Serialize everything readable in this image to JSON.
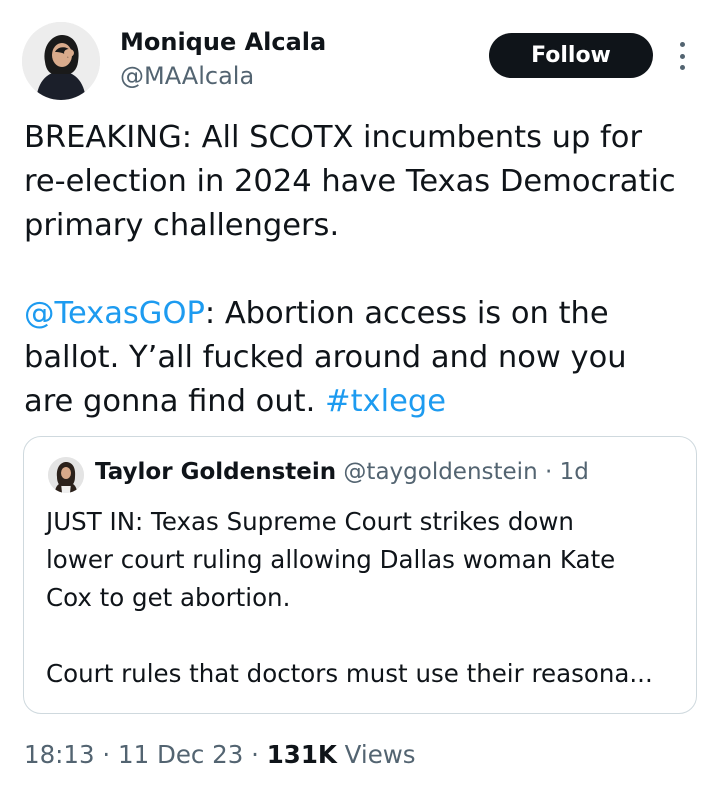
{
  "author": {
    "name": "Monique Alcala",
    "handle": "@MAAlcala",
    "follow_label": "Follow"
  },
  "tweet": {
    "line1": "BREAKING: All SCOTX incumbents up for",
    "line2": "re-election in 2024 have Texas Democratic",
    "line3": "primary challengers.",
    "mention": "@TexasGOP",
    "line4_rest": ": Abortion access is on the",
    "line5": "ballot. Y’all fucked around and  now you",
    "line6_start": "are gonna find out. ",
    "hashtag": "#txlege"
  },
  "quoted_tweet": {
    "name": "Taylor Goldenstein",
    "handle": "@taygoldenstein",
    "separator": "·",
    "time": "1d",
    "line1": "JUST IN: Texas Supreme Court strikes down",
    "line2": "lower court ruling allowing Dallas woman Kate",
    "line3": "Cox to get abortion.",
    "line4": "Court rules that doctors must use their reasona..."
  },
  "meta": {
    "time": "18:13",
    "sep1": "·",
    "date": "11 Dec 23",
    "sep2": "·",
    "views_count": "131K",
    "views_label": "Views"
  },
  "colors": {
    "link": "#1d9bf0",
    "text": "#0f1419",
    "secondary": "#536471",
    "border": "#cfd9de",
    "follow_bg": "#0f1419"
  }
}
